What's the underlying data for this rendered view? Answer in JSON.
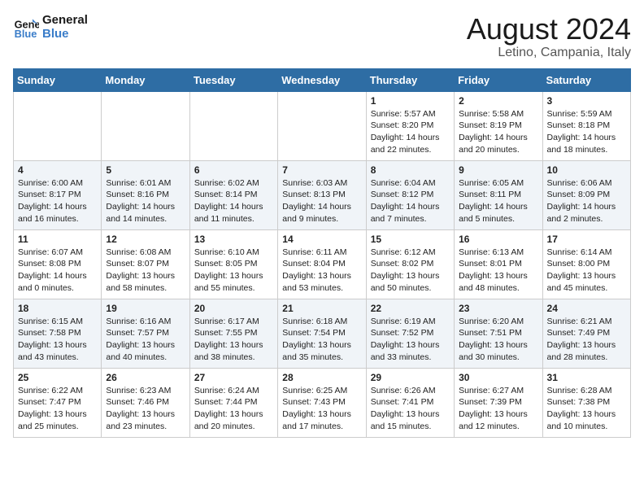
{
  "logo": {
    "text_general": "General",
    "text_blue": "Blue"
  },
  "header": {
    "title": "August 2024",
    "subtitle": "Letino, Campania, Italy"
  },
  "weekdays": [
    "Sunday",
    "Monday",
    "Tuesday",
    "Wednesday",
    "Thursday",
    "Friday",
    "Saturday"
  ],
  "weeks": [
    [
      {
        "day": "",
        "content": ""
      },
      {
        "day": "",
        "content": ""
      },
      {
        "day": "",
        "content": ""
      },
      {
        "day": "",
        "content": ""
      },
      {
        "day": "1",
        "content": "Sunrise: 5:57 AM\nSunset: 8:20 PM\nDaylight: 14 hours\nand 22 minutes."
      },
      {
        "day": "2",
        "content": "Sunrise: 5:58 AM\nSunset: 8:19 PM\nDaylight: 14 hours\nand 20 minutes."
      },
      {
        "day": "3",
        "content": "Sunrise: 5:59 AM\nSunset: 8:18 PM\nDaylight: 14 hours\nand 18 minutes."
      }
    ],
    [
      {
        "day": "4",
        "content": "Sunrise: 6:00 AM\nSunset: 8:17 PM\nDaylight: 14 hours\nand 16 minutes."
      },
      {
        "day": "5",
        "content": "Sunrise: 6:01 AM\nSunset: 8:16 PM\nDaylight: 14 hours\nand 14 minutes."
      },
      {
        "day": "6",
        "content": "Sunrise: 6:02 AM\nSunset: 8:14 PM\nDaylight: 14 hours\nand 11 minutes."
      },
      {
        "day": "7",
        "content": "Sunrise: 6:03 AM\nSunset: 8:13 PM\nDaylight: 14 hours\nand 9 minutes."
      },
      {
        "day": "8",
        "content": "Sunrise: 6:04 AM\nSunset: 8:12 PM\nDaylight: 14 hours\nand 7 minutes."
      },
      {
        "day": "9",
        "content": "Sunrise: 6:05 AM\nSunset: 8:11 PM\nDaylight: 14 hours\nand 5 minutes."
      },
      {
        "day": "10",
        "content": "Sunrise: 6:06 AM\nSunset: 8:09 PM\nDaylight: 14 hours\nand 2 minutes."
      }
    ],
    [
      {
        "day": "11",
        "content": "Sunrise: 6:07 AM\nSunset: 8:08 PM\nDaylight: 14 hours\nand 0 minutes."
      },
      {
        "day": "12",
        "content": "Sunrise: 6:08 AM\nSunset: 8:07 PM\nDaylight: 13 hours\nand 58 minutes."
      },
      {
        "day": "13",
        "content": "Sunrise: 6:10 AM\nSunset: 8:05 PM\nDaylight: 13 hours\nand 55 minutes."
      },
      {
        "day": "14",
        "content": "Sunrise: 6:11 AM\nSunset: 8:04 PM\nDaylight: 13 hours\nand 53 minutes."
      },
      {
        "day": "15",
        "content": "Sunrise: 6:12 AM\nSunset: 8:02 PM\nDaylight: 13 hours\nand 50 minutes."
      },
      {
        "day": "16",
        "content": "Sunrise: 6:13 AM\nSunset: 8:01 PM\nDaylight: 13 hours\nand 48 minutes."
      },
      {
        "day": "17",
        "content": "Sunrise: 6:14 AM\nSunset: 8:00 PM\nDaylight: 13 hours\nand 45 minutes."
      }
    ],
    [
      {
        "day": "18",
        "content": "Sunrise: 6:15 AM\nSunset: 7:58 PM\nDaylight: 13 hours\nand 43 minutes."
      },
      {
        "day": "19",
        "content": "Sunrise: 6:16 AM\nSunset: 7:57 PM\nDaylight: 13 hours\nand 40 minutes."
      },
      {
        "day": "20",
        "content": "Sunrise: 6:17 AM\nSunset: 7:55 PM\nDaylight: 13 hours\nand 38 minutes."
      },
      {
        "day": "21",
        "content": "Sunrise: 6:18 AM\nSunset: 7:54 PM\nDaylight: 13 hours\nand 35 minutes."
      },
      {
        "day": "22",
        "content": "Sunrise: 6:19 AM\nSunset: 7:52 PM\nDaylight: 13 hours\nand 33 minutes."
      },
      {
        "day": "23",
        "content": "Sunrise: 6:20 AM\nSunset: 7:51 PM\nDaylight: 13 hours\nand 30 minutes."
      },
      {
        "day": "24",
        "content": "Sunrise: 6:21 AM\nSunset: 7:49 PM\nDaylight: 13 hours\nand 28 minutes."
      }
    ],
    [
      {
        "day": "25",
        "content": "Sunrise: 6:22 AM\nSunset: 7:47 PM\nDaylight: 13 hours\nand 25 minutes."
      },
      {
        "day": "26",
        "content": "Sunrise: 6:23 AM\nSunset: 7:46 PM\nDaylight: 13 hours\nand 23 minutes."
      },
      {
        "day": "27",
        "content": "Sunrise: 6:24 AM\nSunset: 7:44 PM\nDaylight: 13 hours\nand 20 minutes."
      },
      {
        "day": "28",
        "content": "Sunrise: 6:25 AM\nSunset: 7:43 PM\nDaylight: 13 hours\nand 17 minutes."
      },
      {
        "day": "29",
        "content": "Sunrise: 6:26 AM\nSunset: 7:41 PM\nDaylight: 13 hours\nand 15 minutes."
      },
      {
        "day": "30",
        "content": "Sunrise: 6:27 AM\nSunset: 7:39 PM\nDaylight: 13 hours\nand 12 minutes."
      },
      {
        "day": "31",
        "content": "Sunrise: 6:28 AM\nSunset: 7:38 PM\nDaylight: 13 hours\nand 10 minutes."
      }
    ]
  ]
}
